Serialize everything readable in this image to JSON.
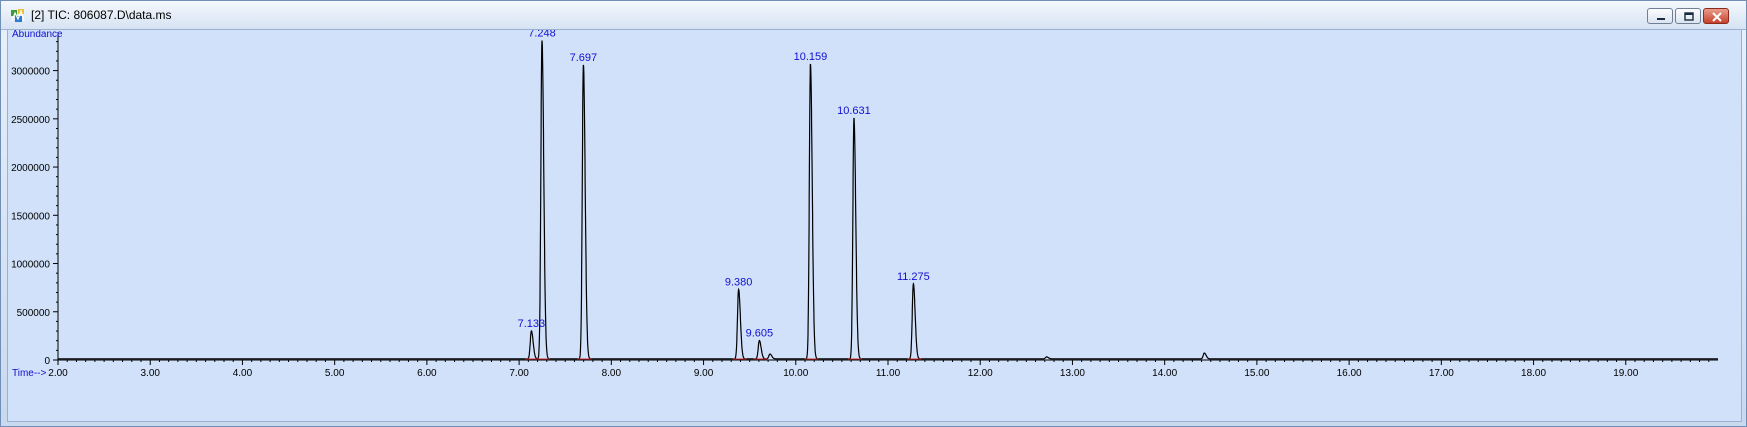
{
  "window": {
    "title": "[2] TIC: 806087.D\\data.ms",
    "icons": {
      "app": "chromatogram-icon",
      "minimize": "minimize-icon",
      "restore": "restore-icon",
      "close": "close-icon"
    }
  },
  "colors": {
    "trace": "#000000",
    "labels": "#1010d0",
    "baseline_marks": "#d03030",
    "plot_bg": "#d1e1f9"
  },
  "chart_data": {
    "type": "line",
    "ylabel": "Abundance",
    "xlabel": "Time-->",
    "xlim": [
      2.0,
      20.0
    ],
    "ylim": [
      0,
      3400000
    ],
    "x_ticks": [
      "2.00",
      "3.00",
      "4.00",
      "5.00",
      "6.00",
      "7.00",
      "8.00",
      "9.00",
      "10.00",
      "11.00",
      "12.00",
      "13.00",
      "14.00",
      "15.00",
      "16.00",
      "17.00",
      "18.00",
      "19.00"
    ],
    "y_ticks": [
      "0",
      "500000",
      "1000000",
      "1500000",
      "2000000",
      "2500000",
      "3000000"
    ],
    "peaks": [
      {
        "time": 7.133,
        "label": "7.133",
        "abundance": 290000
      },
      {
        "time": 7.248,
        "label": "7.248",
        "abundance": 3300000
      },
      {
        "time": 7.697,
        "label": "7.697",
        "abundance": 3050000
      },
      {
        "time": 9.38,
        "label": "9.380",
        "abundance": 720000
      },
      {
        "time": 9.605,
        "label": "9.605",
        "abundance": 190000
      },
      {
        "time": 10.159,
        "label": "10.159",
        "abundance": 3060000
      },
      {
        "time": 10.631,
        "label": "10.631",
        "abundance": 2500000
      },
      {
        "time": 11.275,
        "label": "11.275",
        "abundance": 780000
      }
    ],
    "minor_peaks": [
      {
        "time": 9.72,
        "abundance": 50000
      },
      {
        "time": 12.72,
        "abundance": 20000
      },
      {
        "time": 14.43,
        "abundance": 60000
      }
    ]
  }
}
